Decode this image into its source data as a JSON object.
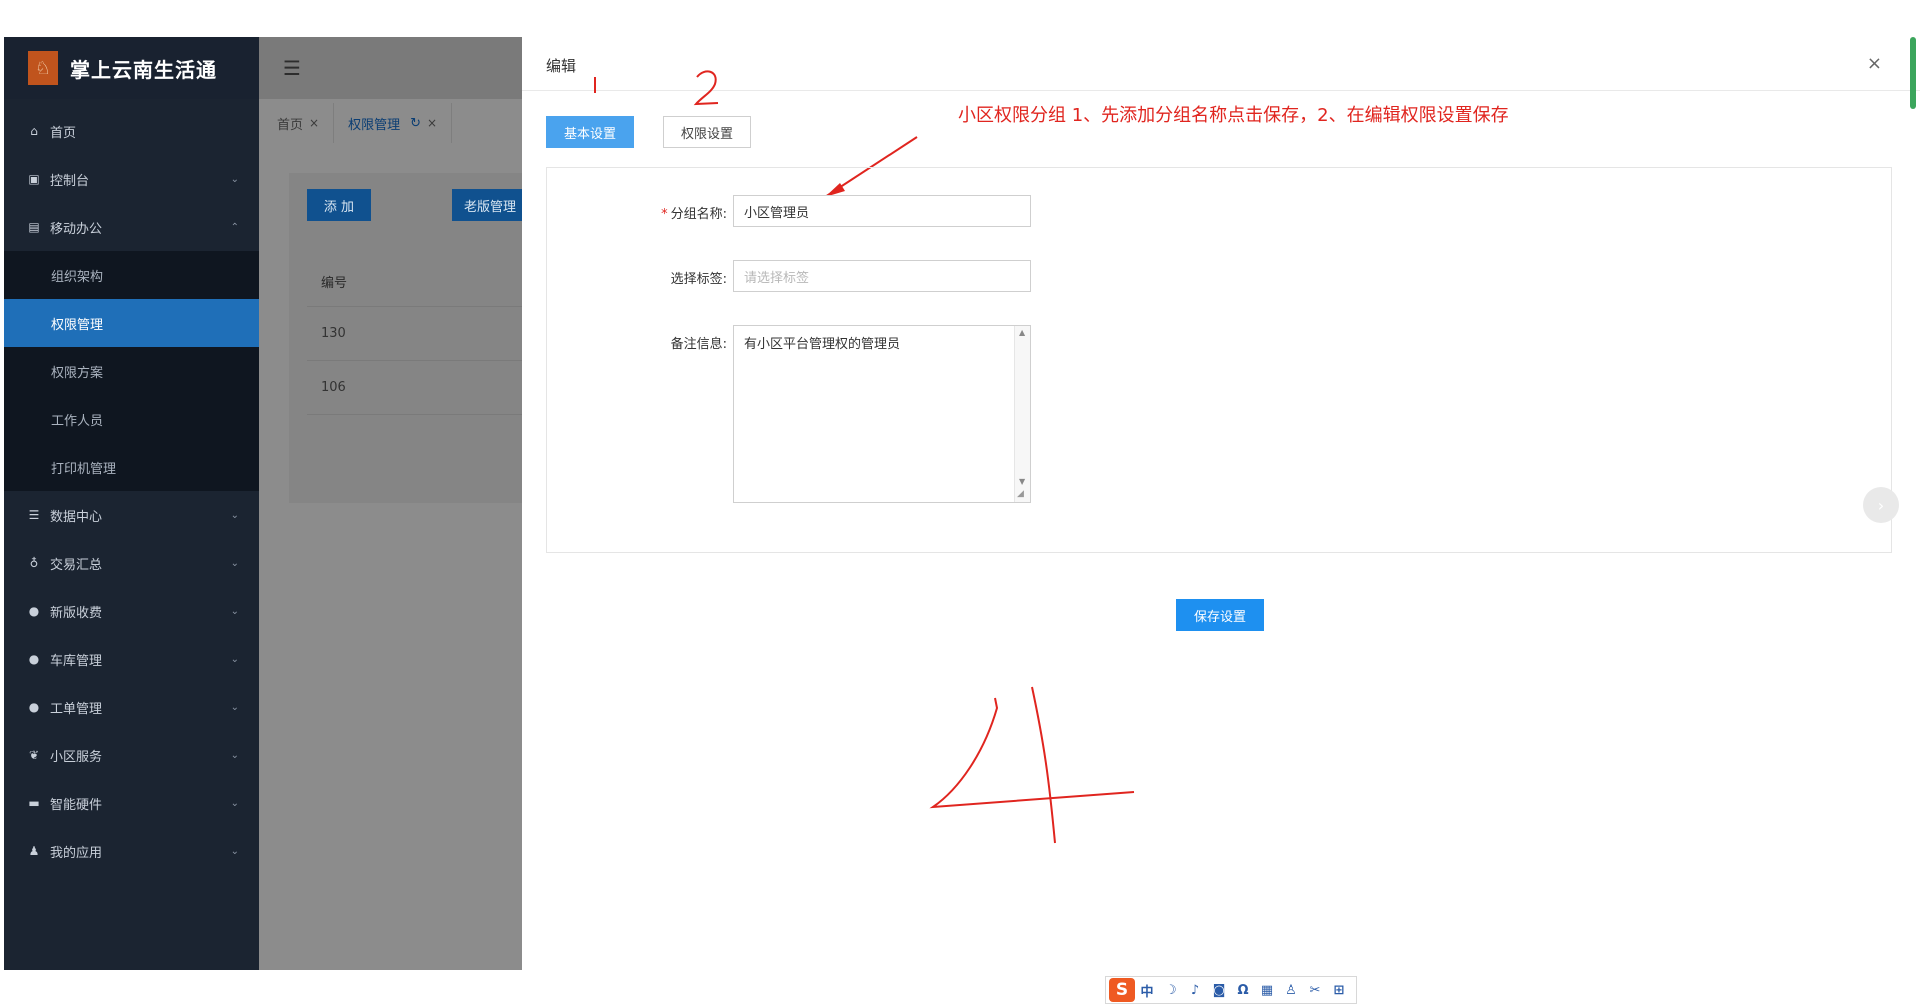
{
  "app": {
    "title": "掌上云南生活通",
    "logo_glyph": "♘"
  },
  "sidebar": {
    "items": [
      {
        "label": "首页",
        "icon": "home-icon",
        "glyph": "⌂",
        "expandable": false
      },
      {
        "label": "控制台",
        "icon": "monitor-icon",
        "glyph": "▣",
        "expandable": true,
        "chevron": "⌄"
      },
      {
        "label": "移动办公",
        "icon": "briefcase-icon",
        "glyph": "▤",
        "expandable": true,
        "chevron": "⌃"
      },
      {
        "label": "数据中心",
        "icon": "database-icon",
        "glyph": "☰",
        "expandable": true,
        "chevron": "⌄"
      },
      {
        "label": "交易汇总",
        "icon": "moneybag-icon",
        "glyph": "♁",
        "expandable": true,
        "chevron": "⌄"
      },
      {
        "label": "新版收费",
        "icon": "chat-icon",
        "glyph": "●",
        "expandable": true,
        "chevron": "⌄"
      },
      {
        "label": "车库管理",
        "icon": "chat-icon",
        "glyph": "●",
        "expandable": true,
        "chevron": "⌄"
      },
      {
        "label": "工单管理",
        "icon": "chat-icon",
        "glyph": "●",
        "expandable": true,
        "chevron": "⌄"
      },
      {
        "label": "小区服务",
        "icon": "leaf-icon",
        "glyph": "❦",
        "expandable": true,
        "chevron": "⌄"
      },
      {
        "label": "智能硬件",
        "icon": "keyboard-icon",
        "glyph": "▬",
        "expandable": true,
        "chevron": "⌄"
      },
      {
        "label": "我的应用",
        "icon": "user-icon",
        "glyph": "♟",
        "expandable": true,
        "chevron": "⌄"
      }
    ],
    "submenu": [
      {
        "label": "组织架构",
        "active": false
      },
      {
        "label": "权限管理",
        "active": true
      },
      {
        "label": "权限方案",
        "active": false
      },
      {
        "label": "工作人员",
        "active": false
      },
      {
        "label": "打印机管理",
        "active": false
      }
    ]
  },
  "topbar": {
    "menu_glyph": "☰"
  },
  "tabs": [
    {
      "label": "首页",
      "close": "×"
    },
    {
      "label": "权限管理",
      "refresh": "↻",
      "close": "×"
    }
  ],
  "content": {
    "add_button": "添 加",
    "old_button": "老版管理",
    "table": {
      "header": "编号",
      "rows": [
        "130",
        "106"
      ]
    }
  },
  "dialog": {
    "title": "编辑",
    "close": "×",
    "tab_basic": "基本设置",
    "tab_permission": "权限设置",
    "fields": {
      "group_name": {
        "required_mark": "*",
        "label": "分组名称:",
        "value": "小区管理员"
      },
      "tag": {
        "label": "选择标签:",
        "placeholder": "请选择标签"
      },
      "remark": {
        "label": "备注信息:",
        "value": "有小区平台管理权的管理员"
      }
    },
    "save_button": "保存设置",
    "next_glyph": "›"
  },
  "annotation": {
    "note": "小区权限分组 1、先添加分组名称点击保存，2、在编辑权限设置保存",
    "mark_1": "1",
    "mark_2": "2",
    "mark_4": "4",
    "color": "#e0251f"
  },
  "ime_toolbar": {
    "logo": "S",
    "icons": [
      {
        "name": "chinese-mode-icon",
        "glyph": "中"
      },
      {
        "name": "moon-icon",
        "glyph": "☽"
      },
      {
        "name": "microphone-icon",
        "glyph": "♪"
      },
      {
        "name": "chat-icon",
        "glyph": "◙"
      },
      {
        "name": "omega-icon",
        "glyph": "Ω"
      },
      {
        "name": "keyboard-icon",
        "glyph": "▦"
      },
      {
        "name": "person-icon",
        "glyph": "♙"
      },
      {
        "name": "scissors-icon",
        "glyph": "✂"
      },
      {
        "name": "apps-icon",
        "glyph": "⊞"
      }
    ]
  },
  "colors": {
    "sidebar_bg": "#1b2431",
    "active_menu": "#1f6fb8",
    "primary": "#1e90f0",
    "annotation": "#e0251f"
  }
}
